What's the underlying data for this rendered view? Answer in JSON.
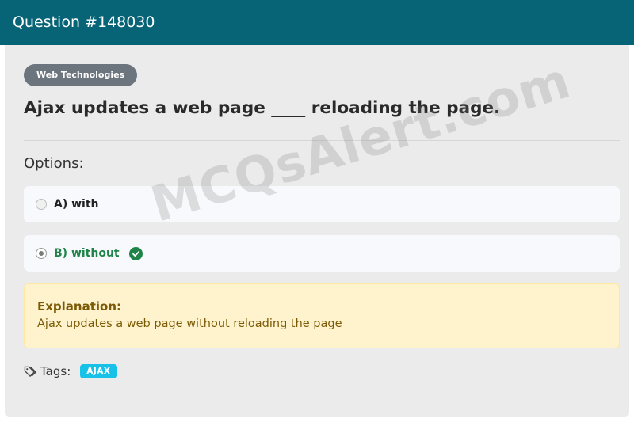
{
  "header": {
    "title": "Question #148030"
  },
  "category": {
    "label": "Web Technologies"
  },
  "question": {
    "text": "Ajax updates a web page ____ reloading the page."
  },
  "options_heading": "Options:",
  "options": [
    {
      "label": "A) with",
      "selected": false,
      "correct": false
    },
    {
      "label": "B) without",
      "selected": true,
      "correct": true
    }
  ],
  "explanation": {
    "title": "Explanation:",
    "body": "Ajax updates a web page without reloading the page"
  },
  "tags": {
    "label": "Tags:",
    "items": [
      "AJAX"
    ]
  },
  "watermark": "MCQsAlert.com",
  "colors": {
    "header_bg": "#076477",
    "correct_green": "#1e8449",
    "tag_badge": "#17c1e8",
    "explanation_bg": "#fff3cd"
  }
}
